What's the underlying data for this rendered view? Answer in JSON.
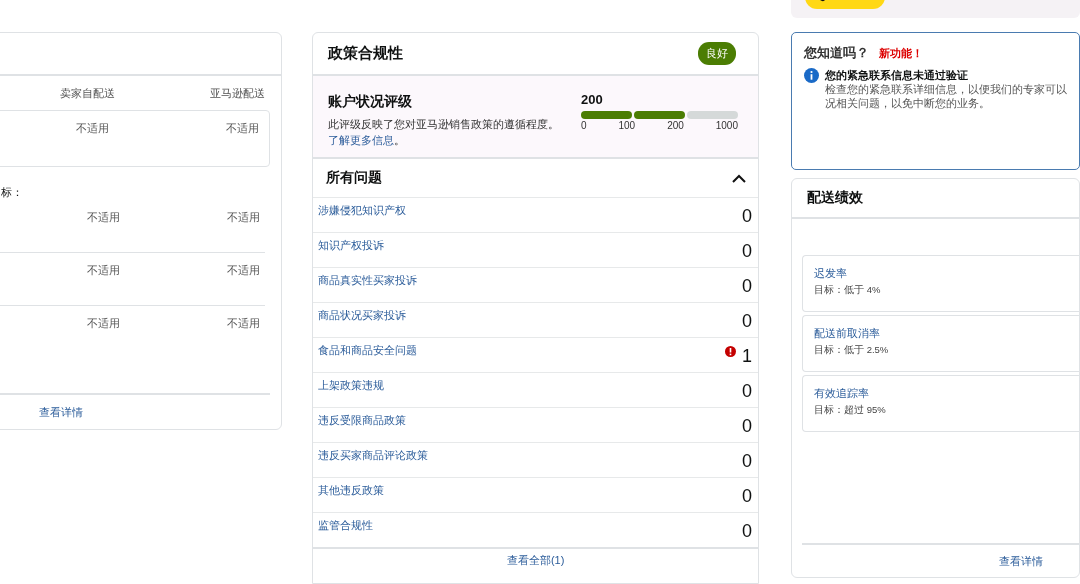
{
  "fulfillment_card": {
    "columns": [
      "卖家自配送",
      "亚马逊配送"
    ],
    "summary_row": [
      "不适用",
      "不适用"
    ],
    "section_label": "标：",
    "rows": [
      [
        "不适用",
        "不适用"
      ],
      [
        "不适用",
        "不适用"
      ],
      [
        "不适用",
        "不适用"
      ]
    ],
    "footer_link": "查看详情"
  },
  "policy_card": {
    "title": "政策合规性",
    "status_badge": "良好",
    "rating": {
      "title": "账户状况评级",
      "description": "此评级反映了您对亚马逊销售政策的遵循程度。",
      "link": "了解更多信息",
      "description_end": "。",
      "score": "200",
      "level": 0.667,
      "ticks": [
        "0",
        "100",
        "200",
        "1000"
      ]
    },
    "issues": {
      "title": "所有问题",
      "expanded": true,
      "rows": [
        {
          "label": "涉嫌侵犯知识产权",
          "count": "0",
          "alert": false
        },
        {
          "label": "知识产权投诉",
          "count": "0",
          "alert": false
        },
        {
          "label": "商品真实性买家投诉",
          "count": "0",
          "alert": false
        },
        {
          "label": "商品状况买家投诉",
          "count": "0",
          "alert": false
        },
        {
          "label": "食品和商品安全问题",
          "count": "1",
          "alert": true
        },
        {
          "label": "上架政策违规",
          "count": "0",
          "alert": false
        },
        {
          "label": "违反受限商品政策",
          "count": "0",
          "alert": false
        },
        {
          "label": "违反买家商品评论政策",
          "count": "0",
          "alert": false
        },
        {
          "label": "其他违反政策",
          "count": "0",
          "alert": false
        },
        {
          "label": "监管合规性",
          "count": "0",
          "alert": false
        }
      ]
    },
    "footer_link": "查看全部(1)"
  },
  "tip_card": {
    "title": "您知道吗？",
    "tag": "新功能！",
    "heading": "您的紧急联系信息未通过验证",
    "lines": [
      "检查您的紧急联系详细信息，以便我们的专家可以",
      "况相关问题，以免中断您的业务。"
    ]
  },
  "delivery_card": {
    "title": "配送绩效",
    "metrics": [
      {
        "name": "迟发率",
        "target": "目标：低于 4%"
      },
      {
        "name": "配送前取消率",
        "target": "目标：低于 2.5%"
      },
      {
        "name": "有效追踪率",
        "target": "目标：超过 95%"
      }
    ],
    "footer_link": "查看详情"
  }
}
